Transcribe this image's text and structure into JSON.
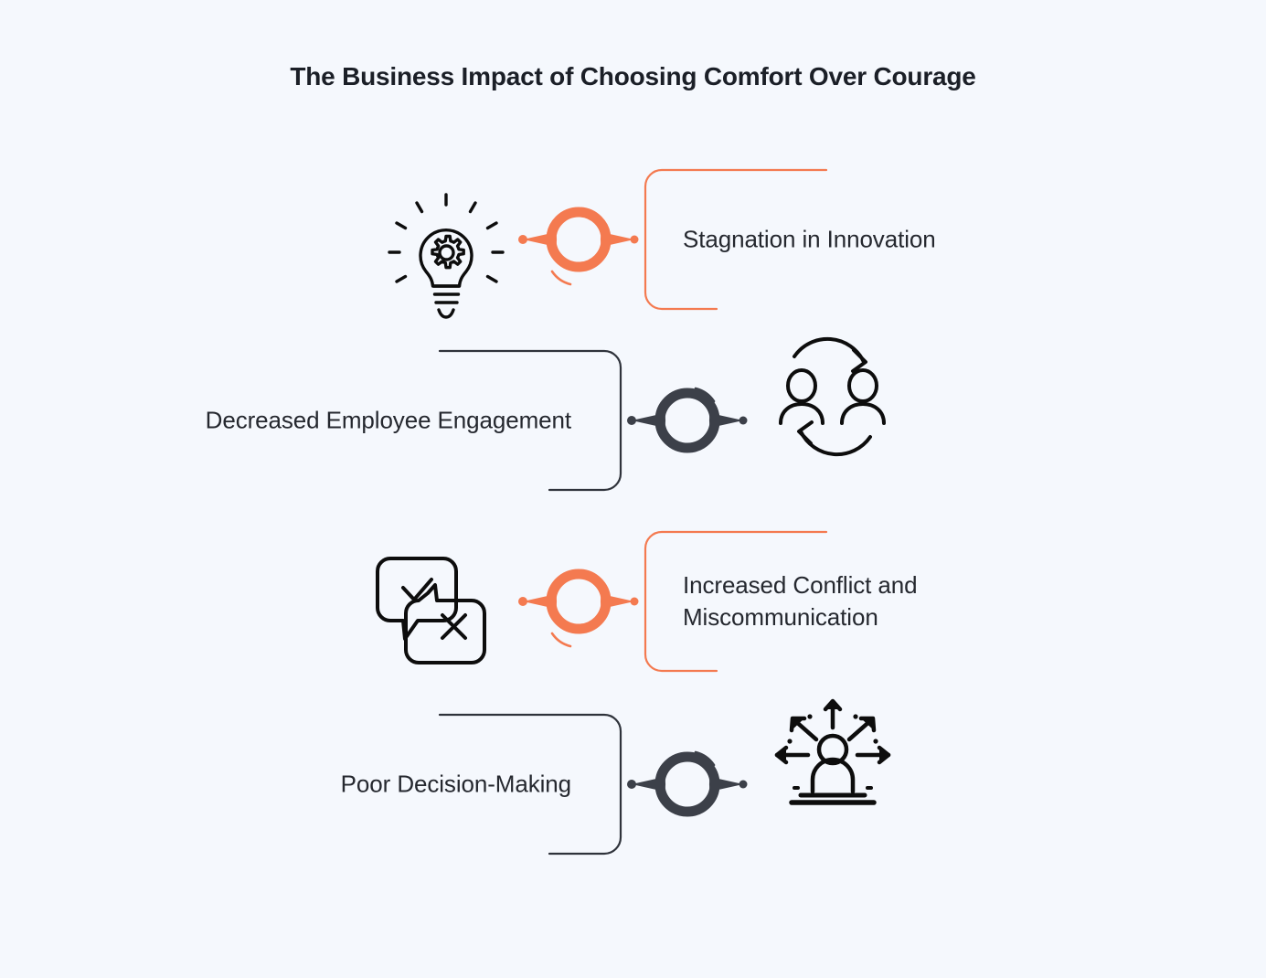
{
  "title": "The Business Impact of Choosing Comfort Over Courage",
  "colors": {
    "background": "#f5f8fd",
    "accent_orange": "#f47a50",
    "dark": "#3c4049",
    "text": "#25282f",
    "title": "#1b1f27",
    "icon_stroke": "#0d0d0d"
  },
  "rows": [
    {
      "label": "Stagnation in Innovation",
      "side": "right",
      "color": "#f47a50",
      "icon": "lightbulb-gear-icon"
    },
    {
      "label": "Decreased Employee Engagement",
      "side": "left",
      "color": "#3c4049",
      "icon": "people-cycle-icon"
    },
    {
      "label": "Increased Conflict and\nMiscommunication",
      "side": "right",
      "color": "#f47a50",
      "icon": "speech-bubbles-check-cross-icon"
    },
    {
      "label": "Poor Decision-Making",
      "side": "left",
      "color": "#3c4049",
      "icon": "person-arrows-decision-icon"
    }
  ]
}
